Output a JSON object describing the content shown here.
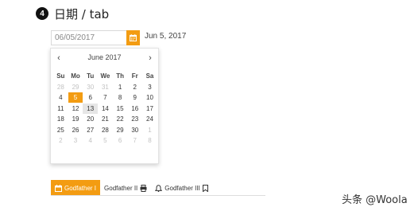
{
  "section": {
    "step": "4",
    "title": "日期 / tab"
  },
  "date_input": {
    "value": "06/05/2017",
    "display": "Jun 5, 2017"
  },
  "datepicker": {
    "month_label": "June 2017",
    "prev_label": "‹",
    "next_label": "›",
    "weekdays": [
      "Su",
      "Mo",
      "Tu",
      "We",
      "Th",
      "Fr",
      "Sa"
    ],
    "weeks": [
      [
        {
          "d": "28",
          "m": true
        },
        {
          "d": "29",
          "m": true
        },
        {
          "d": "30",
          "m": true
        },
        {
          "d": "31",
          "m": true
        },
        {
          "d": "1"
        },
        {
          "d": "2"
        },
        {
          "d": "3"
        }
      ],
      [
        {
          "d": "4"
        },
        {
          "d": "5",
          "sel": true
        },
        {
          "d": "6"
        },
        {
          "d": "7"
        },
        {
          "d": "8"
        },
        {
          "d": "9"
        },
        {
          "d": "10"
        }
      ],
      [
        {
          "d": "11"
        },
        {
          "d": "12"
        },
        {
          "d": "13",
          "today": true
        },
        {
          "d": "14"
        },
        {
          "d": "15"
        },
        {
          "d": "16"
        },
        {
          "d": "17"
        }
      ],
      [
        {
          "d": "18"
        },
        {
          "d": "19"
        },
        {
          "d": "20"
        },
        {
          "d": "21"
        },
        {
          "d": "22"
        },
        {
          "d": "23"
        },
        {
          "d": "24"
        }
      ],
      [
        {
          "d": "25"
        },
        {
          "d": "26"
        },
        {
          "d": "27"
        },
        {
          "d": "28"
        },
        {
          "d": "29"
        },
        {
          "d": "30"
        },
        {
          "d": "1",
          "m": true
        }
      ],
      [
        {
          "d": "2",
          "m": true
        },
        {
          "d": "3",
          "m": true
        },
        {
          "d": "4",
          "m": true
        },
        {
          "d": "5",
          "m": true
        },
        {
          "d": "6",
          "m": true
        },
        {
          "d": "7",
          "m": true
        },
        {
          "d": "8",
          "m": true
        }
      ]
    ]
  },
  "tabs": [
    {
      "label": "Godfather I",
      "icon": "calendar-icon",
      "active": true
    },
    {
      "label": "Godfather II",
      "icon": "print-icon",
      "active": false
    },
    {
      "label": "Godfather III",
      "icon": "bell-icon",
      "icon2": "bookmark-icon",
      "active": false
    }
  ],
  "watermark": "头条 @Woola",
  "colors": {
    "accent": "#f39c12",
    "muted": "#c2c2c2",
    "today_bg": "#e6e6e6"
  }
}
